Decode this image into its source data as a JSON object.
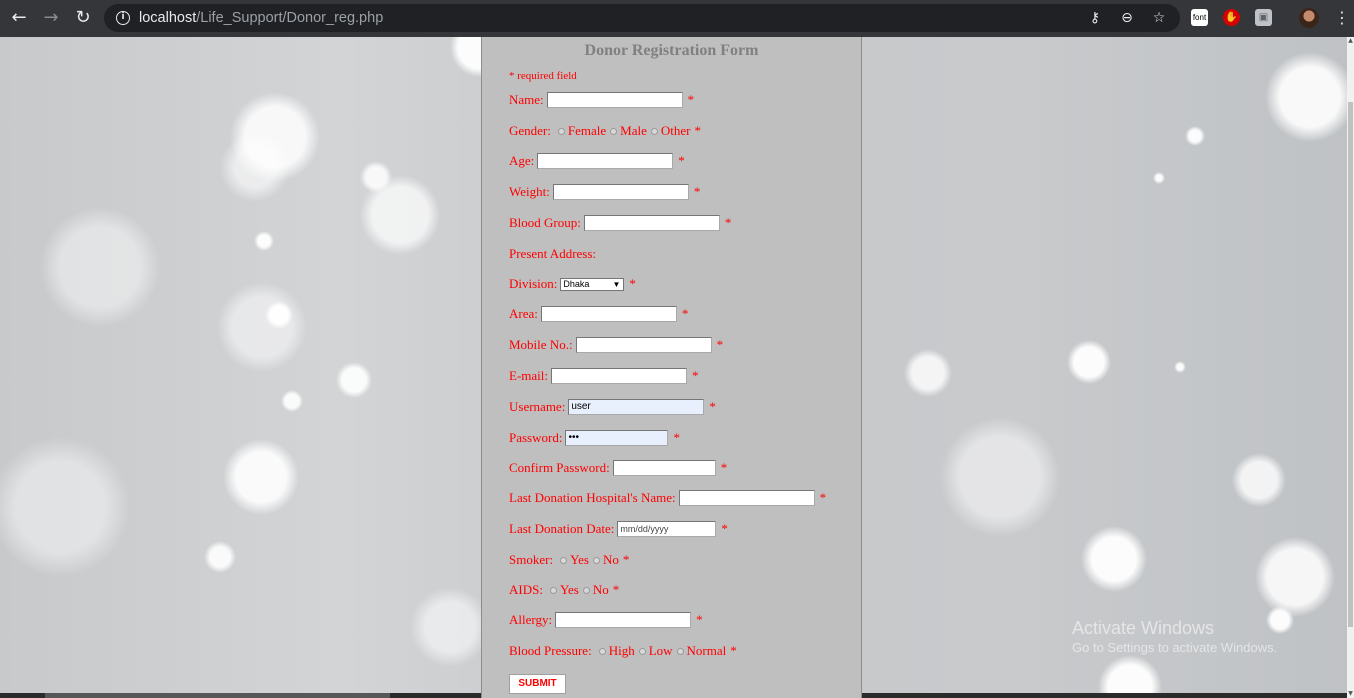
{
  "browser": {
    "url_host": "localhost",
    "url_path": "/Life_Support/Donor_reg.php",
    "icons": {
      "back": "back-arrow-icon",
      "forward": "forward-arrow-icon",
      "reload": "reload-icon",
      "info": "info-icon",
      "key": "key-icon",
      "zoom": "zoom-icon",
      "star": "star-icon",
      "menu": "kebab-menu-icon"
    },
    "extensions": [
      {
        "name": "font-extension",
        "label": "font"
      },
      {
        "name": "stop-extension",
        "label": "✋"
      },
      {
        "name": "box-extension",
        "label": "▣"
      }
    ]
  },
  "form": {
    "title": "Donor Registration Form",
    "required_note": "* required field",
    "star": "*",
    "name_label": "Name:",
    "name_value": "",
    "gender_label": "Gender:",
    "gender_options": [
      "Female",
      "Male",
      "Other"
    ],
    "age_label": "Age:",
    "weight_label": "Weight:",
    "blood_group_label": "Blood Group:",
    "present_address_label": "Present Address:",
    "division_label": "Division:",
    "division_value": "Dhaka",
    "area_label": "Area:",
    "mobile_label": "Mobile No.:",
    "email_label": "E-mail:",
    "username_label": "Username:",
    "username_value": "user",
    "password_label": "Password:",
    "password_value": "•••",
    "confirm_password_label": "Confirm Password:",
    "hospital_label": "Last Donation Hospital's Name:",
    "last_date_label": "Last Donation Date:",
    "last_date_placeholder": "mm/dd/yyyy",
    "smoker_label": "Smoker:",
    "yes": "Yes",
    "no": "No",
    "aids_label": "AIDS:",
    "allergy_label": "Allergy:",
    "bp_label": "Blood Pressure:",
    "bp_options": [
      "High",
      "Low",
      "Normal"
    ],
    "submit_label": "SUBMIT"
  },
  "watermark": {
    "title": "Activate Windows",
    "subtitle": "Go to Settings to activate Windows."
  },
  "colors": {
    "label": "#ff0000",
    "title": "#808080",
    "panel": "#bfbfbf",
    "autofill": "#e8f0fe"
  }
}
